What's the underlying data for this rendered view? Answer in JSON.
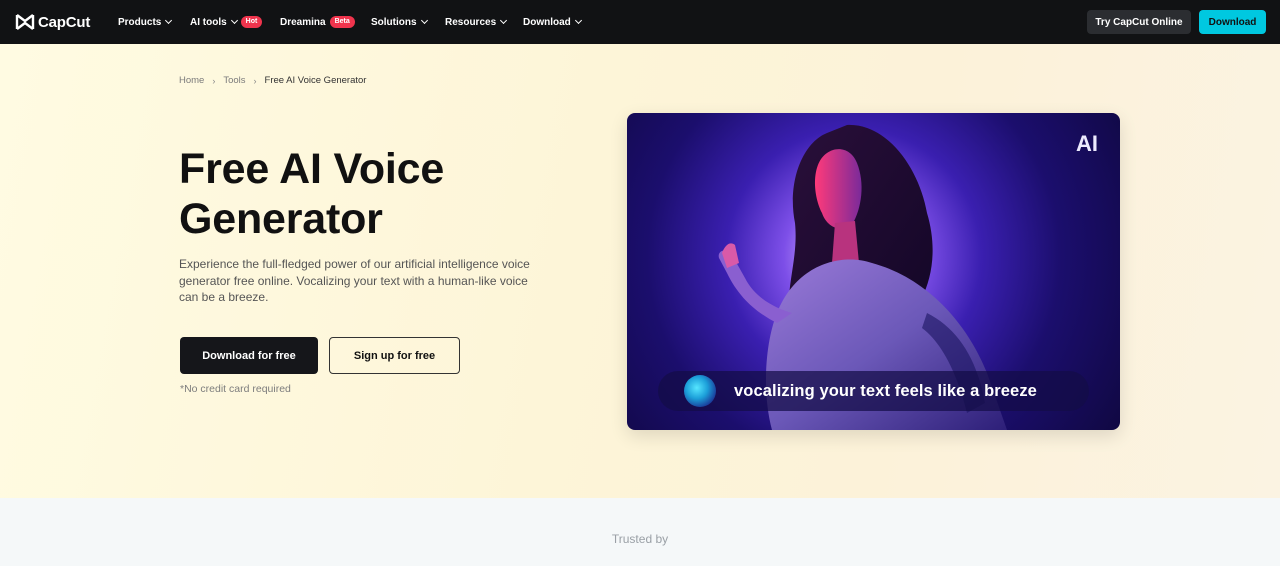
{
  "nav": {
    "logo_text": "CapCut",
    "items": [
      {
        "label": "Products",
        "badge": ""
      },
      {
        "label": "AI tools",
        "badge": "Hot"
      },
      {
        "label": "Dreamina",
        "badge": "Beta"
      },
      {
        "label": "Solutions",
        "badge": ""
      },
      {
        "label": "Resources",
        "badge": ""
      },
      {
        "label": "Download",
        "badge": ""
      }
    ],
    "try_online": "Try CapCut Online",
    "download": "Download"
  },
  "breadcrumb": {
    "home": "Home",
    "tools": "Tools",
    "current": "Free AI Voice Generator",
    "separator": "›"
  },
  "hero": {
    "title": "Free AI Voice Generator",
    "description": "Experience the full-fledged power of our artificial intelligence voice generator free online. Vocalizing your text with a human-like voice can be a breeze.",
    "primary_button": "Download for free",
    "secondary_button": "Sign up for free",
    "note": "*No credit card required"
  },
  "media": {
    "badge": "AI",
    "caption": "vocalizing your text feels like a breeze"
  },
  "trusted": {
    "label": "Trusted by"
  },
  "colors": {
    "nav_bg": "#111214",
    "accent": "#00c8e0",
    "hot_badge": "#f0344d",
    "primary_button": "#15161a"
  }
}
